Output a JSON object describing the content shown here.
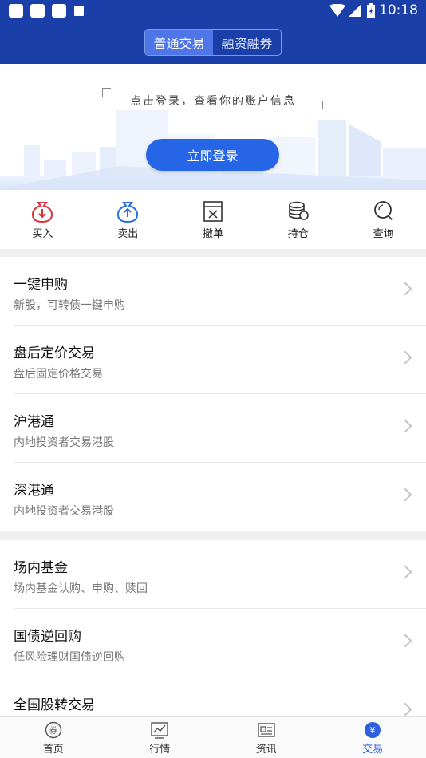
{
  "status_bar": {
    "time": "10:18"
  },
  "header": {
    "tabs": [
      {
        "label": "普通交易",
        "active": true
      },
      {
        "label": "融资融券",
        "active": false
      }
    ]
  },
  "banner": {
    "hint": "点击登录，查看你的账户信息",
    "login_button": "立即登录"
  },
  "quick_actions": [
    {
      "label": "买入",
      "icon": "buy-down-arrow-icon",
      "color": "#d8323c"
    },
    {
      "label": "卖出",
      "icon": "sell-up-arrow-icon",
      "color": "#2d6fe0"
    },
    {
      "label": "撤单",
      "icon": "cancel-order-icon",
      "color": "#333333"
    },
    {
      "label": "持仓",
      "icon": "coins-stack-icon",
      "color": "#333333"
    },
    {
      "label": "查询",
      "icon": "search-icon",
      "color": "#333333"
    }
  ],
  "list_groups": [
    [
      {
        "title": "一键申购",
        "subtitle": "新股，可转债一键申购"
      },
      {
        "title": "盘后定价交易",
        "subtitle": "盘后固定价格交易"
      },
      {
        "title": "沪港通",
        "subtitle": "内地投资者交易港股"
      },
      {
        "title": "深港通",
        "subtitle": "内地投资者交易港股"
      }
    ],
    [
      {
        "title": "场内基金",
        "subtitle": "场内基金认购、申购、赎回"
      },
      {
        "title": "国债逆回购",
        "subtitle": "低风险理财国债逆回购"
      },
      {
        "title": "全国股转交易",
        "subtitle": ""
      }
    ]
  ],
  "bottom_nav": [
    {
      "label": "首页",
      "icon": "coupon-icon",
      "active": false
    },
    {
      "label": "行情",
      "icon": "chart-icon",
      "active": false
    },
    {
      "label": "资讯",
      "icon": "news-icon",
      "active": false
    },
    {
      "label": "交易",
      "icon": "yen-icon",
      "active": true
    }
  ],
  "colors": {
    "brand": "#1b3fa8",
    "accent": "#2666e6",
    "active_nav": "#2d5fe0"
  }
}
